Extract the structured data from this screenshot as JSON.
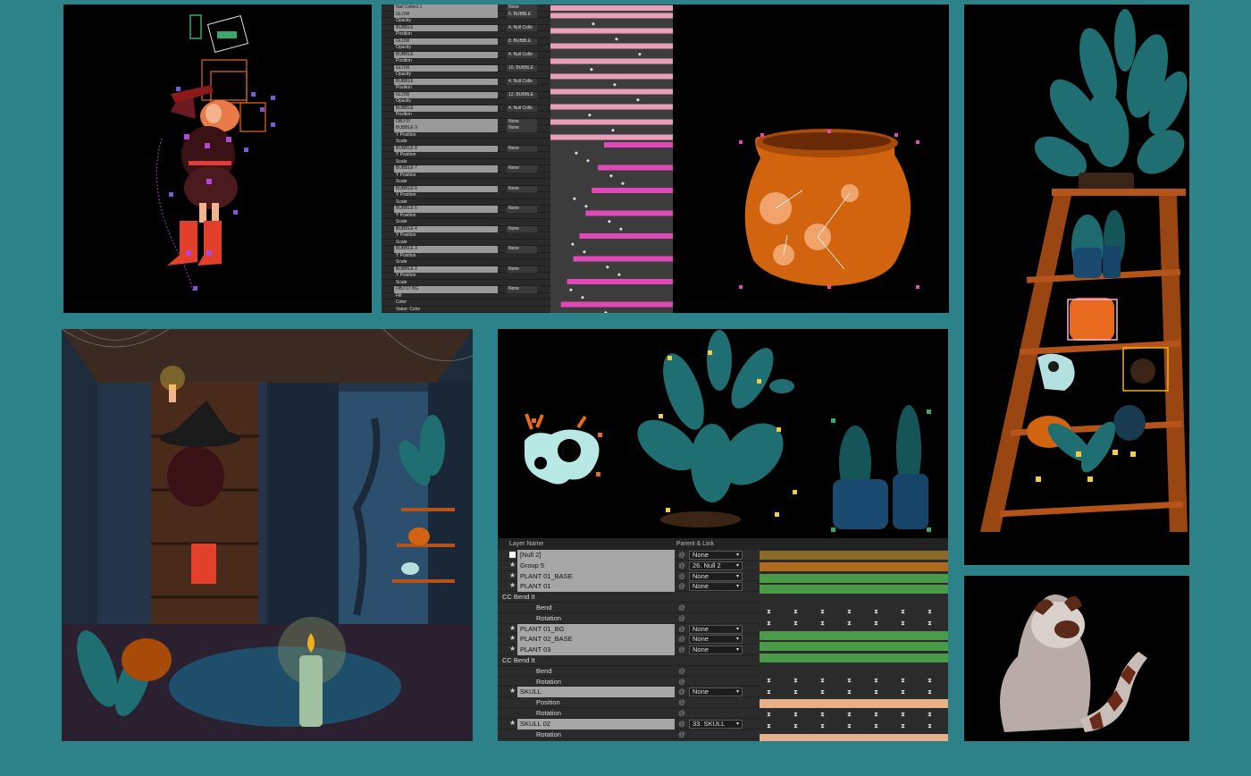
{
  "timeline_top": {
    "rows": [
      {
        "kind": "layer",
        "name": "Null Collect 1",
        "parent": "None"
      },
      {
        "kind": "layer",
        "name": "GLOW",
        "parent": "6. BUBBLE"
      },
      {
        "kind": "prop",
        "name": "Opacity"
      },
      {
        "kind": "layer",
        "name": "BUBBLE",
        "parent": "4. Null Colle"
      },
      {
        "kind": "prop",
        "name": "Position"
      },
      {
        "kind": "layer",
        "name": "GLOW",
        "parent": "8. BUBBLE"
      },
      {
        "kind": "prop",
        "name": "Opacity"
      },
      {
        "kind": "layer",
        "name": "BUBBLE",
        "parent": "4. Null Colle"
      },
      {
        "kind": "prop",
        "name": "Position"
      },
      {
        "kind": "layer",
        "name": "GLOW",
        "parent": "10. BUBBLE"
      },
      {
        "kind": "prop",
        "name": "Opacity"
      },
      {
        "kind": "layer",
        "name": "BUBBLE",
        "parent": "4. Null Colle"
      },
      {
        "kind": "prop",
        "name": "Position"
      },
      {
        "kind": "layer",
        "name": "GLOW",
        "parent": "12. BUBBLE"
      },
      {
        "kind": "prop",
        "name": "Opacity"
      },
      {
        "kind": "layer",
        "name": "BUBBLE",
        "parent": "4. Null Colle"
      },
      {
        "kind": "prop",
        "name": "Position"
      },
      {
        "kind": "layer",
        "name": "OBJ 07",
        "parent": "None"
      },
      {
        "kind": "layer",
        "name": "BUBBLE 9",
        "parent": "None"
      },
      {
        "kind": "prop",
        "name": "Y Position"
      },
      {
        "kind": "prop",
        "name": "Scale"
      },
      {
        "kind": "layer",
        "name": "BUBBLE 8",
        "parent": "None"
      },
      {
        "kind": "prop",
        "name": "Y Position"
      },
      {
        "kind": "prop",
        "name": "Scale"
      },
      {
        "kind": "layer",
        "name": "BUBBLE 7",
        "parent": "None"
      },
      {
        "kind": "prop",
        "name": "Y Position"
      },
      {
        "kind": "prop",
        "name": "Scale"
      },
      {
        "kind": "layer",
        "name": "BUBBLE 6",
        "parent": "None"
      },
      {
        "kind": "prop",
        "name": "Y Position"
      },
      {
        "kind": "prop",
        "name": "Scale"
      },
      {
        "kind": "layer",
        "name": "BUBBLE 5",
        "parent": "None"
      },
      {
        "kind": "prop",
        "name": "Y Position"
      },
      {
        "kind": "prop",
        "name": "Scale"
      },
      {
        "kind": "layer",
        "name": "BUBBLE 4",
        "parent": "None"
      },
      {
        "kind": "prop",
        "name": "Y Position"
      },
      {
        "kind": "prop",
        "name": "Scale"
      },
      {
        "kind": "layer",
        "name": "BUBBLE 3",
        "parent": "None"
      },
      {
        "kind": "prop",
        "name": "Y Position"
      },
      {
        "kind": "prop",
        "name": "Scale"
      },
      {
        "kind": "layer",
        "name": "BUBBLE 2",
        "parent": "None"
      },
      {
        "kind": "prop",
        "name": "Y Position"
      },
      {
        "kind": "prop",
        "name": "Scale"
      },
      {
        "kind": "layer",
        "name": "OBJ 07 BG",
        "parent": "None"
      },
      {
        "kind": "prop",
        "name": "Fill"
      },
      {
        "kind": "prop",
        "name": "Color"
      },
      {
        "kind": "prop",
        "name": "Value: Color"
      }
    ]
  },
  "timeline_bottom": {
    "header": {
      "layer_name": "Layer Name",
      "parent_link": "Parent & Link"
    },
    "rows": [
      {
        "kind": "layer",
        "name": "[Null 2]",
        "parent": "None",
        "bar": "#8a6a28",
        "icon": "square"
      },
      {
        "kind": "layer",
        "name": "Group 5",
        "parent": "26. Null 2",
        "bar": "#b06a1e",
        "icon": "star"
      },
      {
        "kind": "layer",
        "name": "PLANT 01_BASE",
        "parent": "None",
        "bar": "#4a9a4a",
        "icon": "star"
      },
      {
        "kind": "layer",
        "name": "PLANT 01",
        "parent": "None",
        "bar": "#4a9a4a",
        "icon": "star"
      },
      {
        "kind": "effect",
        "name": "CC Bend It"
      },
      {
        "kind": "prop",
        "name": "Bend"
      },
      {
        "kind": "prop",
        "name": "Rotation"
      },
      {
        "kind": "layer",
        "name": "PLANT 01_BG",
        "parent": "None",
        "bar": "#4a9a4a",
        "icon": "star"
      },
      {
        "kind": "layer",
        "name": "PLANT 02_BASE",
        "parent": "None",
        "bar": "#4a9a4a",
        "icon": "star"
      },
      {
        "kind": "layer",
        "name": "PLANT 03",
        "parent": "None",
        "bar": "#4a9a4a",
        "icon": "star"
      },
      {
        "kind": "effect",
        "name": "CC Bend It"
      },
      {
        "kind": "prop",
        "name": "Bend"
      },
      {
        "kind": "prop",
        "name": "Rotation"
      },
      {
        "kind": "layer",
        "name": "SKULL",
        "parent": "None",
        "bar": "#e6b08a",
        "icon": "star"
      },
      {
        "kind": "prop",
        "name": "Position"
      },
      {
        "kind": "prop",
        "name": "Rotation"
      },
      {
        "kind": "layer",
        "name": "SKULL 02",
        "parent": "33. SKULL",
        "bar": "#e6b08a",
        "icon": "star"
      },
      {
        "kind": "prop",
        "name": "Rotation"
      }
    ]
  },
  "colors": {
    "background": "#2d8289",
    "cauldron": "#d2640f",
    "timeline_bar_pink": "#e04ab8",
    "plant_teal": "#1f6f72"
  }
}
